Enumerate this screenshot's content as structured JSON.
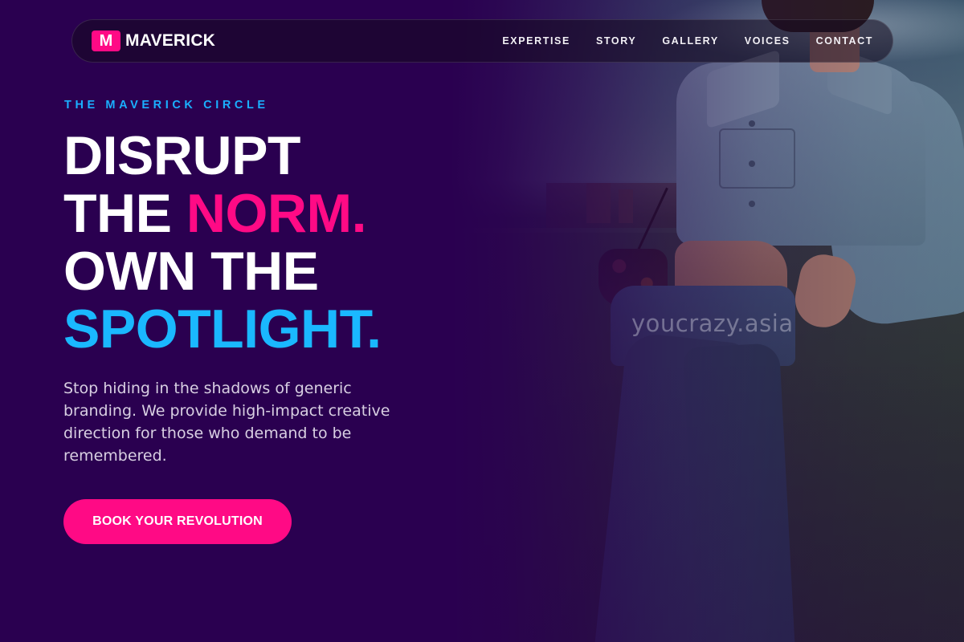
{
  "nav": {
    "brand_mark": "M",
    "brand_name": "MAVERICK",
    "links": [
      "EXPERTISE",
      "STORY",
      "GALLERY",
      "VOICES",
      "CONTACT"
    ]
  },
  "hero": {
    "eyebrow": "THE MAVERICK CIRCLE",
    "headline": {
      "line1": "DISRUPT",
      "line2_a": "THE ",
      "line2_b": "NORM.",
      "line3": "OWN THE",
      "line4": "SPOTLIGHT."
    },
    "body": "Stop hiding in the shadows of generic branding. We provide high-impact creative direction for those who demand to be remembered.",
    "cta_label": "BOOK YOUR REVOLUTION"
  },
  "watermark": "youcrazy.asia",
  "colors": {
    "background": "#2a0050",
    "accent_pink": "#ff0a85",
    "accent_cyan": "#1ab8ff"
  }
}
